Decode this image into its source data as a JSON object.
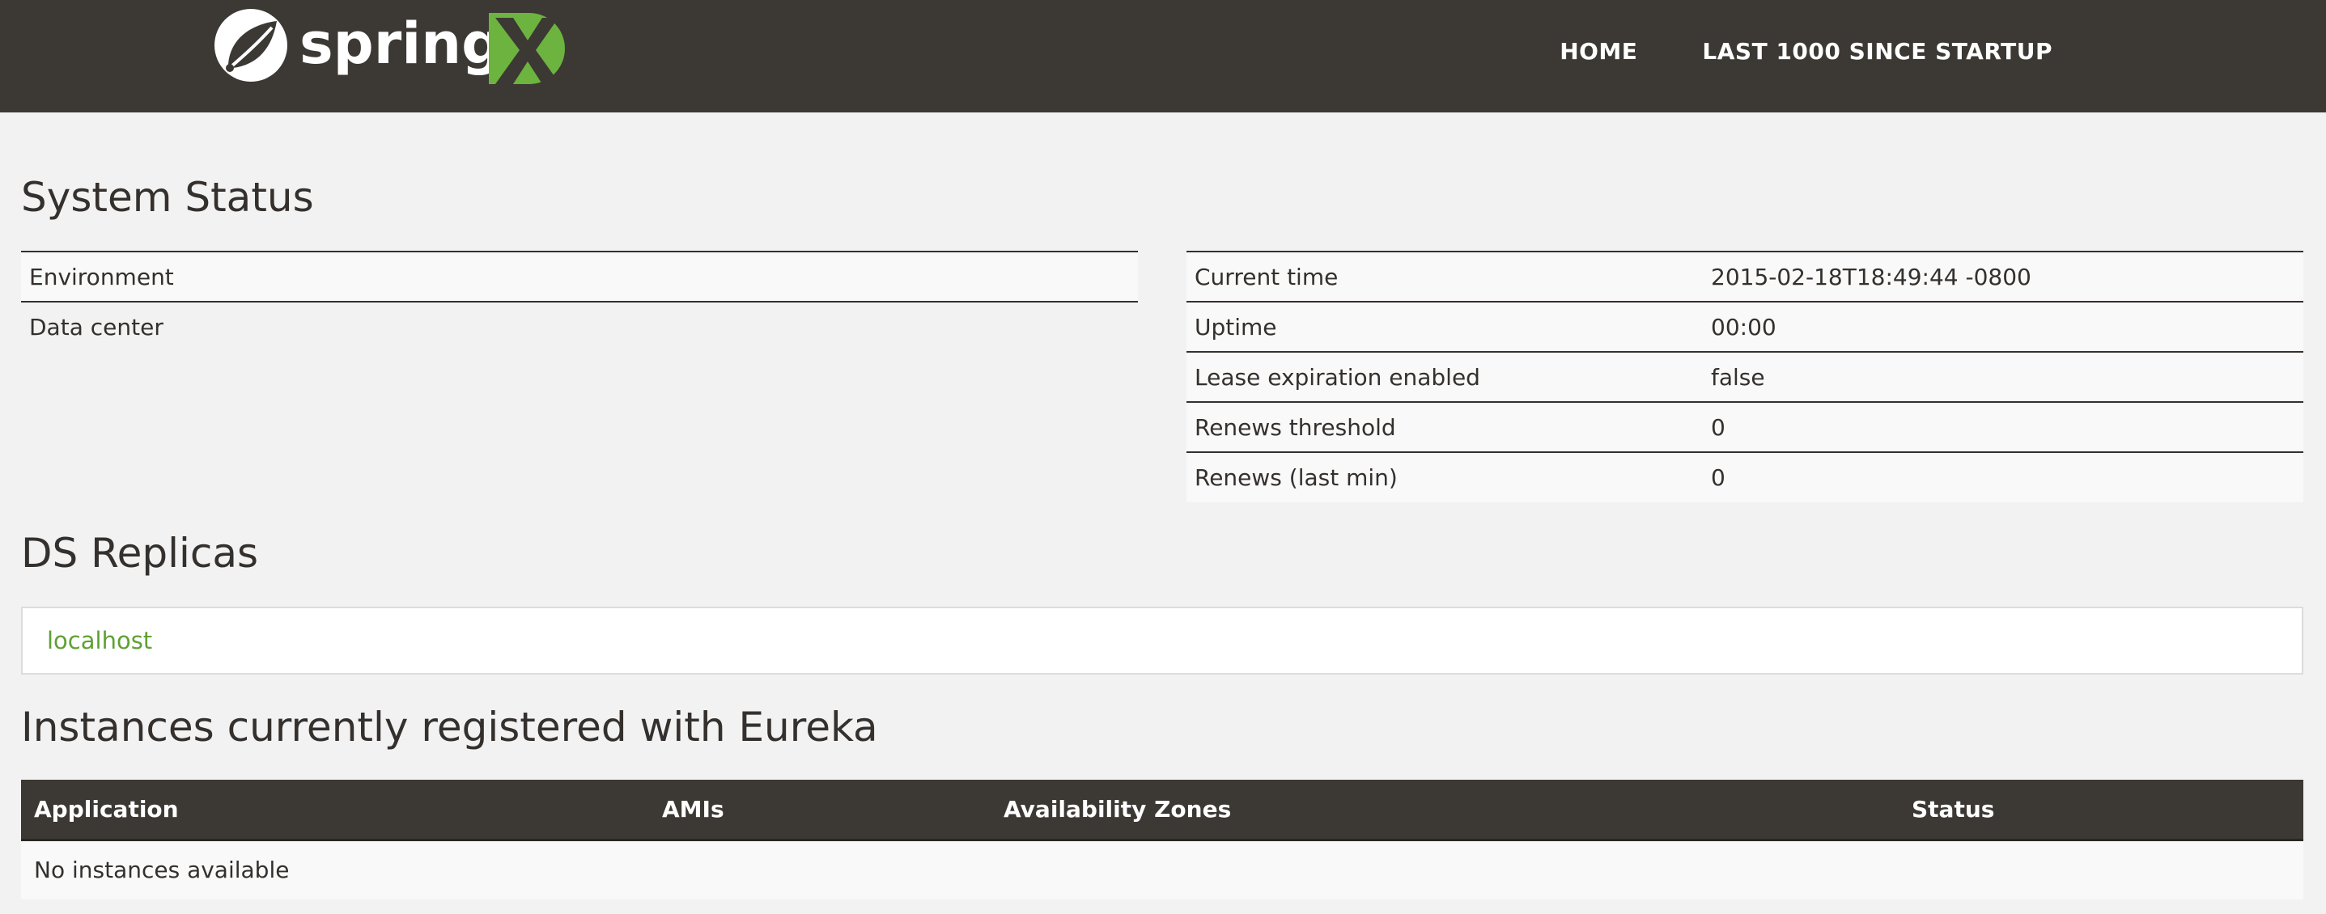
{
  "navbar": {
    "brand": "spring",
    "links": [
      "HOME",
      "LAST 1000 SINCE STARTUP"
    ]
  },
  "system_status": {
    "title": "System Status",
    "left_rows": [
      {
        "label": "Environment",
        "value": ""
      },
      {
        "label": "Data center",
        "value": ""
      }
    ],
    "right_rows": [
      {
        "label": "Current time",
        "value": "2015-02-18T18:49:44 -0800"
      },
      {
        "label": "Uptime",
        "value": "00:00"
      },
      {
        "label": "Lease expiration enabled",
        "value": "false"
      },
      {
        "label": "Renews threshold",
        "value": "0"
      },
      {
        "label": "Renews (last min)",
        "value": "0"
      }
    ]
  },
  "replicas": {
    "title": "DS Replicas",
    "items": [
      "localhost"
    ]
  },
  "instances": {
    "title": "Instances currently registered with Eureka",
    "columns": [
      "Application",
      "AMIs",
      "Availability Zones",
      "Status"
    ],
    "empty_message": "No instances available"
  },
  "colors": {
    "navbar": "#3c3834",
    "background": "#f2f2f2",
    "brand_green": "#6db33f",
    "link_green": "#5fa134"
  },
  "icons": {
    "spring_leaf": "spring-leaf-icon",
    "cloud_x": "spring-cloud-x-logo"
  }
}
